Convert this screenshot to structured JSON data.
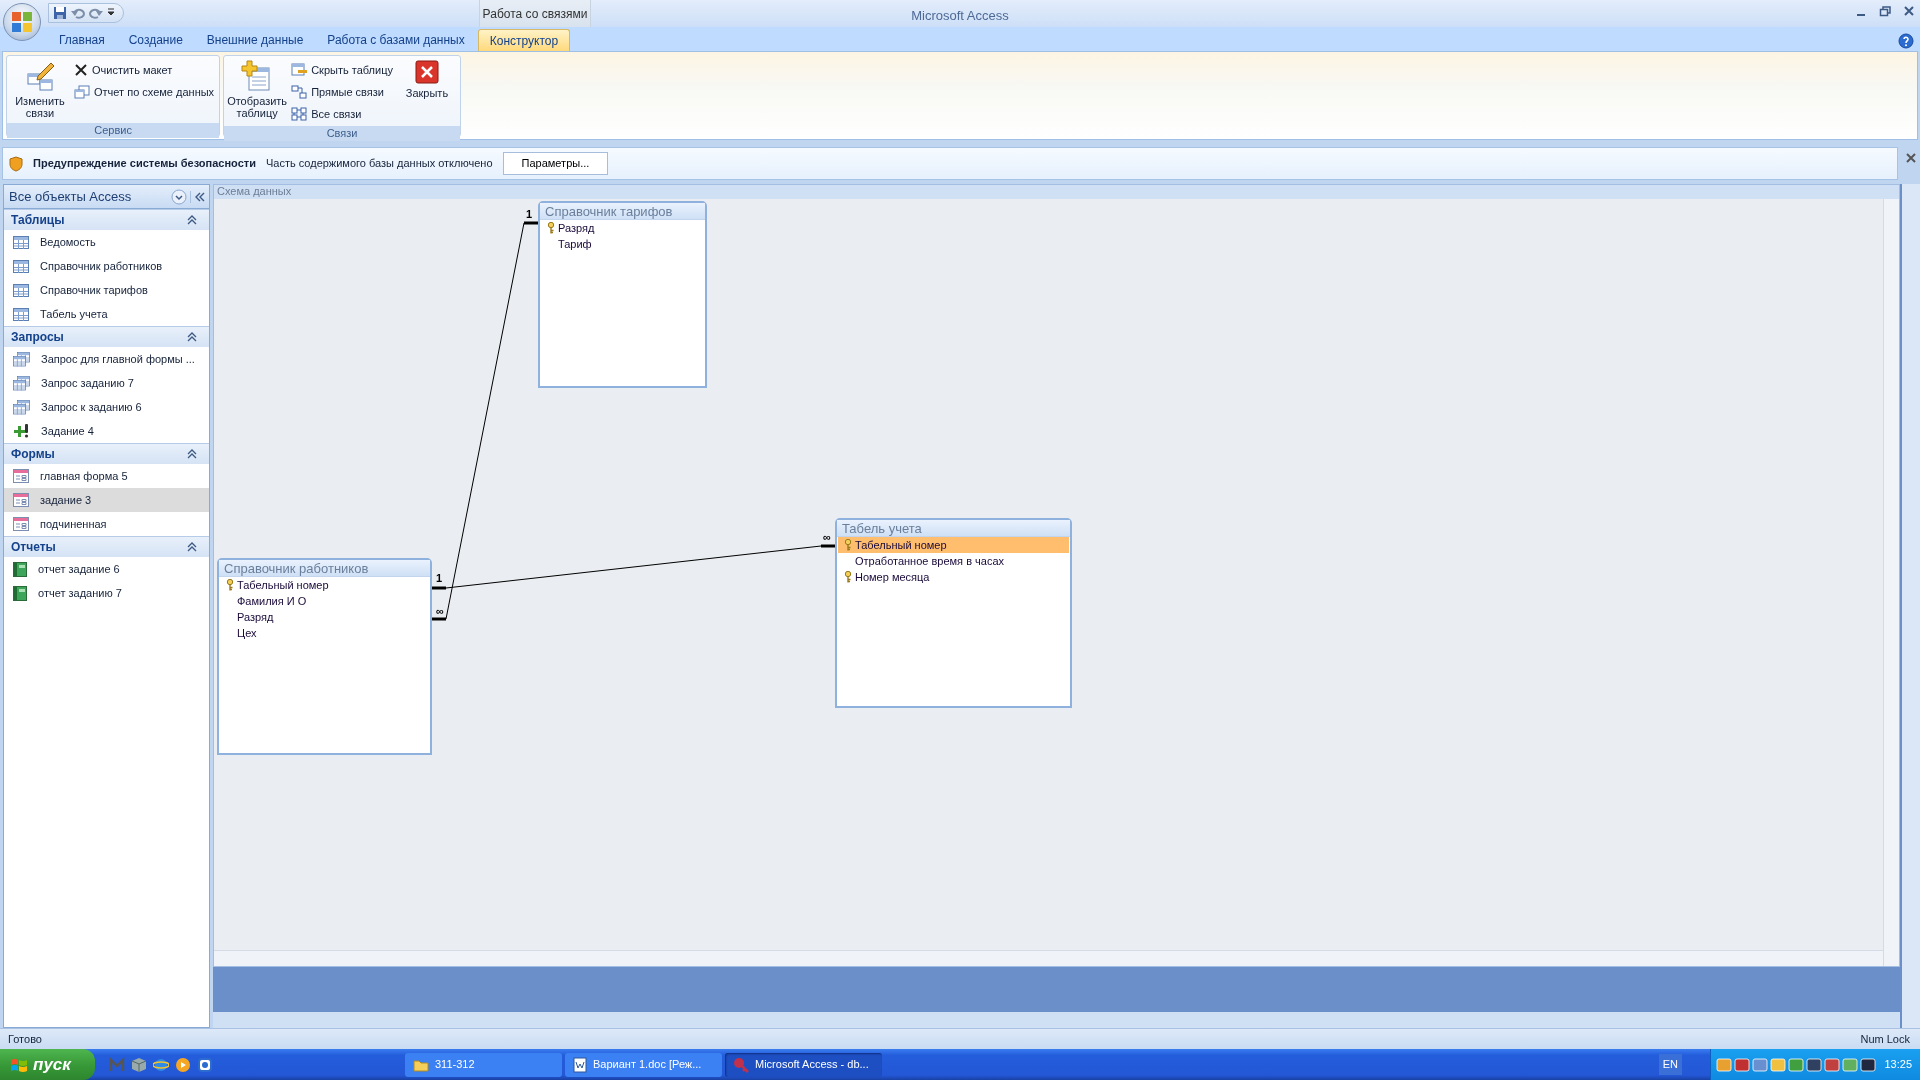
{
  "window": {
    "title": "Microsoft Access"
  },
  "ribbon": {
    "context_group": "Работа со связями",
    "tabs": [
      {
        "label": "Главная",
        "selected": false
      },
      {
        "label": "Создание",
        "selected": false
      },
      {
        "label": "Внешние данные",
        "selected": false
      },
      {
        "label": "Работа с базами данных",
        "selected": false
      },
      {
        "label": "Конструктор",
        "selected": true
      }
    ],
    "groups": [
      {
        "label": "Сервис",
        "buttons": [
          {
            "kind": "large",
            "label": "Изменить связи"
          },
          {
            "kind": "small",
            "label": "Очистить макет"
          },
          {
            "kind": "small",
            "label": "Отчет по схеме данных"
          }
        ]
      },
      {
        "label": "Связи",
        "buttons": [
          {
            "kind": "large",
            "label": "Отобразить таблицу"
          },
          {
            "kind": "small",
            "label": "Скрыть таблицу"
          },
          {
            "kind": "small",
            "label": "Прямые связи"
          },
          {
            "kind": "small",
            "label": "Все связи"
          },
          {
            "kind": "large",
            "label": "Закрыть"
          }
        ]
      }
    ]
  },
  "security_bar": {
    "title": "Предупреждение системы безопасности",
    "message": "Часть содержимого базы данных отключено",
    "button": "Параметры..."
  },
  "navigation": {
    "title": "Все объекты Access",
    "groups": [
      {
        "label": "Таблицы",
        "expanded": true,
        "items": [
          {
            "label": "Ведомость",
            "kind": "table",
            "selected": false
          },
          {
            "label": "Справочник работников",
            "kind": "table",
            "selected": false
          },
          {
            "label": "Справочник тарифов",
            "kind": "table",
            "selected": false
          },
          {
            "label": "Табель учета",
            "kind": "table",
            "selected": false
          }
        ]
      },
      {
        "label": "Запросы",
        "expanded": true,
        "items": [
          {
            "label": "Запрос для главной формы ...",
            "kind": "query",
            "selected": false
          },
          {
            "label": "Запрос заданию 7",
            "kind": "query",
            "selected": false
          },
          {
            "label": "Запрос к заданию 6",
            "kind": "query",
            "selected": false
          },
          {
            "label": "Задание 4",
            "kind": "append",
            "selected": false
          }
        ]
      },
      {
        "label": "Формы",
        "expanded": true,
        "items": [
          {
            "label": "главная форма 5",
            "kind": "form",
            "selected": false
          },
          {
            "label": "задание 3",
            "kind": "form",
            "selected": true
          },
          {
            "label": "подчиненная",
            "kind": "form",
            "selected": false
          }
        ]
      },
      {
        "label": "Отчеты",
        "expanded": true,
        "items": [
          {
            "label": "отчет задание 6",
            "kind": "report",
            "selected": false
          },
          {
            "label": "отчет заданию 7",
            "kind": "report",
            "selected": false
          }
        ]
      }
    ]
  },
  "schema_window": {
    "title": "Схема данных",
    "tables": [
      {
        "title": "Справочник тарифов",
        "fields": [
          {
            "name": "Разряд",
            "key": true,
            "selected": false
          },
          {
            "name": "Тариф",
            "key": false,
            "selected": false
          }
        ]
      },
      {
        "title": "Справочник работников",
        "fields": [
          {
            "name": "Табельный номер",
            "key": true,
            "selected": false
          },
          {
            "name": "Фамилия И О",
            "key": false,
            "selected": false
          },
          {
            "name": "Разряд",
            "key": false,
            "selected": false
          },
          {
            "name": "Цех",
            "key": false,
            "selected": false
          }
        ]
      },
      {
        "title": "Табель учета",
        "fields": [
          {
            "name": "Табельный номер",
            "key": true,
            "selected": true
          },
          {
            "name": "Отработанное время в часах",
            "key": false,
            "selected": false
          },
          {
            "name": "Номер месяца",
            "key": true,
            "selected": false
          }
        ]
      }
    ],
    "relationships": [
      {
        "start_label": "1",
        "end_label": "∞"
      },
      {
        "start_label": "∞",
        "end_label": "1"
      }
    ]
  },
  "status_bar": {
    "left": "Готово",
    "right": "Num Lock"
  },
  "taskbar": {
    "start": "пуск",
    "tasks": [
      {
        "label": "311-312",
        "kind": "folder",
        "selected": false
      },
      {
        "label": "Вариант 1.doc [Реж...",
        "kind": "word",
        "selected": false
      },
      {
        "label": "Microsoft Access - db...",
        "kind": "access",
        "selected": true
      }
    ],
    "language": "EN",
    "clock": "13:25"
  }
}
